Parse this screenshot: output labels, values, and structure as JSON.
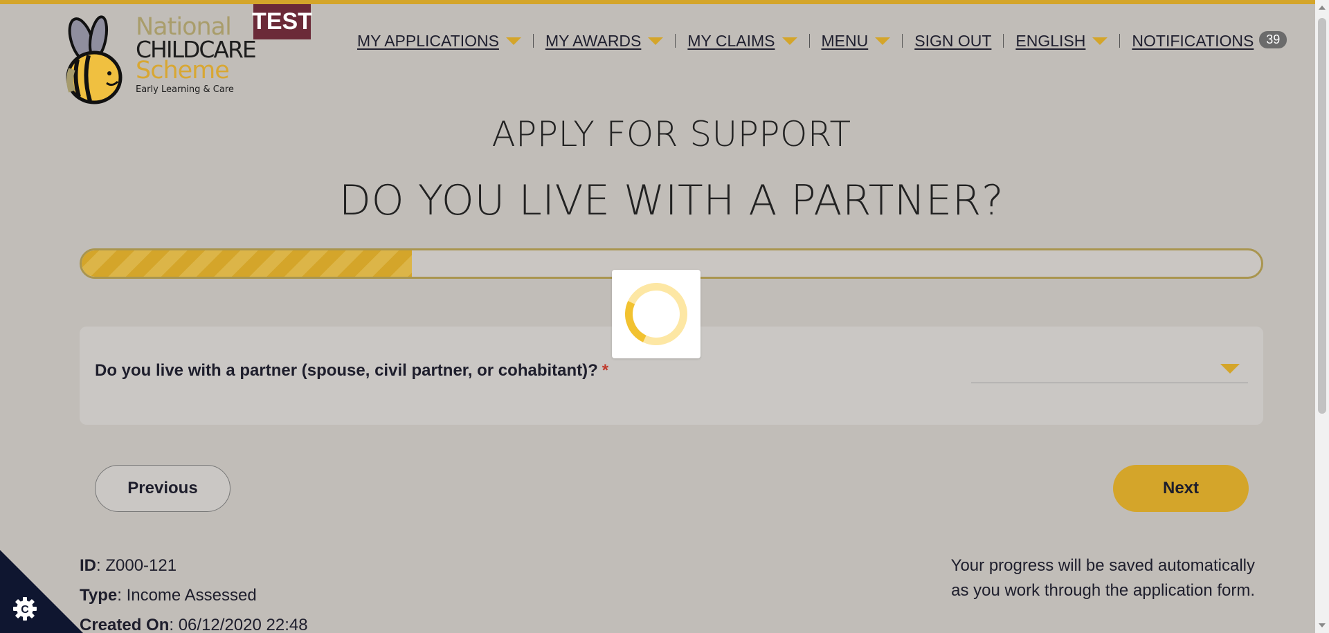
{
  "brand": {
    "line1": "National",
    "line2": "CHILDCARE",
    "line3": "Scheme",
    "tagline": "Early Learning & Care",
    "env_badge": "TEST",
    "accent_color": "#d4a52a"
  },
  "nav": {
    "my_applications": "MY APPLICATIONS",
    "my_awards": "MY AWARDS",
    "my_claims": "MY CLAIMS",
    "menu": "MENU",
    "sign_out": "SIGN OUT",
    "language": "ENGLISH",
    "notifications": "NOTIFICATIONS",
    "notifications_count": "39"
  },
  "page": {
    "title": "APPLY FOR SUPPORT",
    "step_title": "DO YOU LIVE WITH A PARTNER?",
    "progress_fraction": 0.28,
    "loading": true
  },
  "question": {
    "label": "Do you live with a partner (spouse, civil partner, or cohabitant)?",
    "required_mark": "*",
    "selected_value": ""
  },
  "buttons": {
    "previous": "Previous",
    "next": "Next"
  },
  "meta": {
    "id_label": "ID",
    "id_value": ": Z000-121",
    "type_label": "Type",
    "type_value": ": Income Assessed",
    "created_label": "Created On",
    "created_value": ": 06/12/2020 22:48",
    "autosave_line1": "Your progress will be saved automatically",
    "autosave_line2": "as you work through the application form."
  },
  "icons": {
    "cookie": "cookie-settings-icon",
    "dropdown": "chevron-down-icon",
    "spinner": "loading-spinner-icon"
  }
}
